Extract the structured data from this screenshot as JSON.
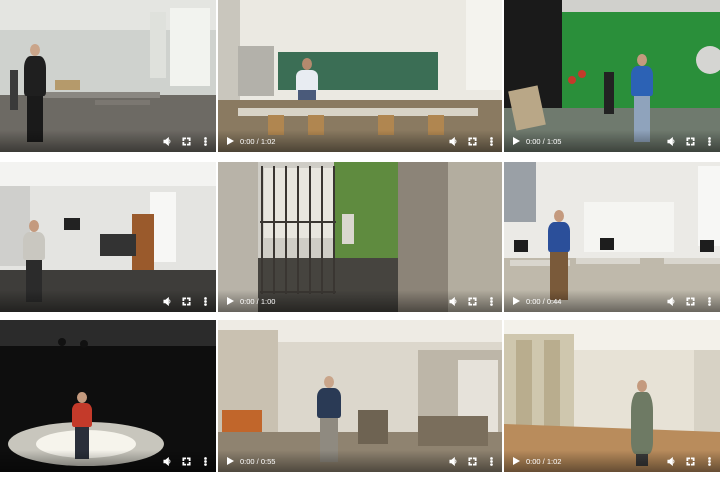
{
  "tiles": [
    {
      "id": "classroom-lab",
      "time": "",
      "colors": {
        "sky": "#c9ccc8",
        "floor": "#6a6761",
        "accent": "#d8dad6"
      }
    },
    {
      "id": "classroom-chalkboard",
      "time": "0:00 / 1:02",
      "colors": {
        "sky": "#e8e6de",
        "floor": "#a88e66",
        "accent": "#3b6e55"
      }
    },
    {
      "id": "green-screen-studio",
      "time": "0:00 / 1:05",
      "colors": {
        "sky": "#2a8f3a",
        "floor": "#6f7a6e",
        "accent": "#1b1b1b"
      }
    },
    {
      "id": "photo-studio",
      "time": "",
      "colors": {
        "sky": "#dcdcda",
        "floor": "#3e3d3a",
        "accent": "#9a5a2c"
      }
    },
    {
      "id": "school-gate",
      "time": "0:00 / 1:00",
      "colors": {
        "sky": "#cfcdc6",
        "floor": "#46443f",
        "accent": "#5f8b3f"
      }
    },
    {
      "id": "computer-room",
      "time": "0:00 / 0:44",
      "colors": {
        "sky": "#e9e8e4",
        "floor": "#bcb6a9",
        "accent": "#2b4f9a"
      }
    },
    {
      "id": "black-box-stage",
      "time": "",
      "colors": {
        "sky": "#0e0e0e",
        "floor": "#222",
        "accent": "#f1efe6"
      }
    },
    {
      "id": "science-storage",
      "time": "0:00 / 0:55",
      "colors": {
        "sky": "#d9d4c9",
        "floor": "#8f8370",
        "accent": "#c1662b"
      }
    },
    {
      "id": "dance-hall",
      "time": "0:00 / 1:02",
      "colors": {
        "sky": "#e6e1d4",
        "floor": "#b98c5c",
        "accent": "#7a8a6a"
      }
    }
  ],
  "icons": [
    "play-icon",
    "volume-icon",
    "fullscreen-icon",
    "more-icon"
  ]
}
